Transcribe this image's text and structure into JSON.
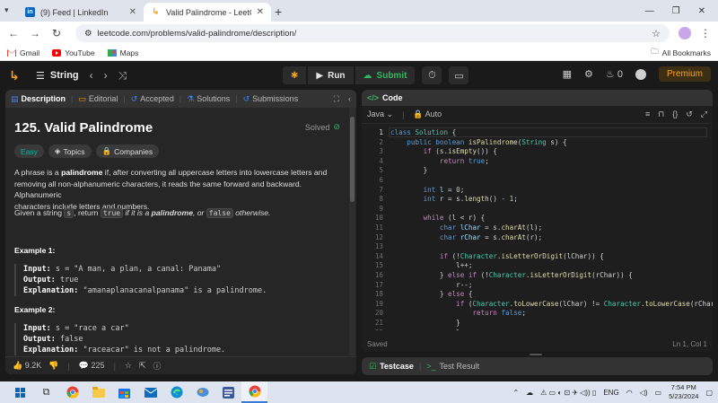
{
  "browser": {
    "tabs": [
      {
        "title": "(9) Feed | LinkedIn",
        "favicon": "linkedin-icon",
        "active": false
      },
      {
        "title": "Valid Palindrome - LeetCode",
        "favicon": "leetcode-icon",
        "active": true
      }
    ],
    "url": "leetcode.com/problems/valid-palindrome/description/",
    "bookmarks": [
      {
        "label": "Gmail",
        "icon": "gmail-icon"
      },
      {
        "label": "YouTube",
        "icon": "youtube-icon"
      },
      {
        "label": "Maps",
        "icon": "maps-icon"
      }
    ],
    "all_bookmarks": "All Bookmarks"
  },
  "header": {
    "problem_list": "String",
    "run_label": "Run",
    "submit_label": "Submit",
    "streak_count": "0",
    "premium_label": "Premium"
  },
  "left_panel": {
    "tabs": [
      "Description",
      "Editorial",
      "Accepted",
      "Solutions",
      "Submissions"
    ],
    "title": "125. Valid Palindrome",
    "status": "Solved",
    "tags": [
      "Easy",
      "Topics",
      "Companies"
    ],
    "desc_1": "A phrase is a ",
    "desc_bold": "palindrome",
    "desc_2": " if, after converting all uppercase letters into lowercase letters and",
    "desc_line2": "removing all non-alphanumeric characters, it reads the same forward and backward. Alphanumeric",
    "desc_line3": "characters include letters and numbers.",
    "given_1": "Given a string ",
    "given_code1": "s",
    "given_2": ", return ",
    "given_code2": "true",
    "given_3": " if it is a ",
    "given_bold": "palindrome",
    "given_4": ", or ",
    "given_code3": "false",
    "given_5": " otherwise.",
    "examples": [
      {
        "title": "Example 1:",
        "input_label": "Input:",
        "input": " s = \"A man, a plan, a canal: Panama\"",
        "output_label": "Output:",
        "output": " true",
        "expl_label": "Explanation:",
        "expl": " \"amanaplanacanalpanama\" is a palindrome."
      },
      {
        "title": "Example 2:",
        "input_label": "Input:",
        "input": " s = \"race a car\"",
        "output_label": "Output:",
        "output": " false",
        "expl_label": "Explanation:",
        "expl": " \"raceacar\" is not a palindrome."
      }
    ],
    "likes": "9.2K",
    "comments": "225"
  },
  "right_panel": {
    "title": "Code",
    "language": "Java",
    "mode": "Auto",
    "status_left": "Saved",
    "status_right": "Ln 1, Col 1",
    "testcase_label": "Testcase",
    "testresult_label": "Test Result"
  },
  "taskbar": {
    "language": "ENG",
    "time": "7:54 PM",
    "date": "5/23/2024"
  },
  "colors": {
    "accent_orange": "#ffa116",
    "accent_green": "#2cbb5d",
    "easy": "#00b8a3"
  }
}
